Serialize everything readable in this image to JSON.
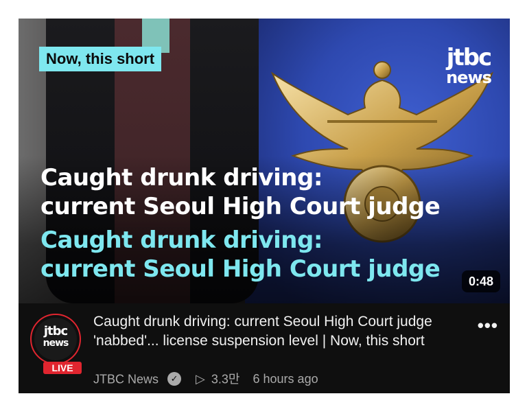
{
  "thumbnail": {
    "tag": "Now, this short",
    "logo_line1": "jtbc",
    "logo_line2": "news",
    "headline_white_1": "Caught drunk driving:",
    "headline_white_2": "current Seoul High Court judge",
    "headline_cyan_1": "Caught drunk driving:",
    "headline_cyan_2": "current Seoul High Court judge",
    "duration": "0:48"
  },
  "video": {
    "title": "Caught drunk driving: current Seoul High Court judge 'nabbed'... license suspension level | Now, this short",
    "channel": "JTBC News",
    "views": "3.3만",
    "time_ago": "6 hours ago",
    "live_badge": "LIVE",
    "avatar_line1": "jtbc",
    "avatar_line2": "news"
  },
  "icons": {
    "verified": "checkmark-badge-icon",
    "views": "play-outline-icon",
    "more": "more-vertical-icon"
  },
  "colors": {
    "accent_cyan": "#7ee7ef",
    "live_red": "#e0252f",
    "card_bg": "#0f0f0f"
  }
}
